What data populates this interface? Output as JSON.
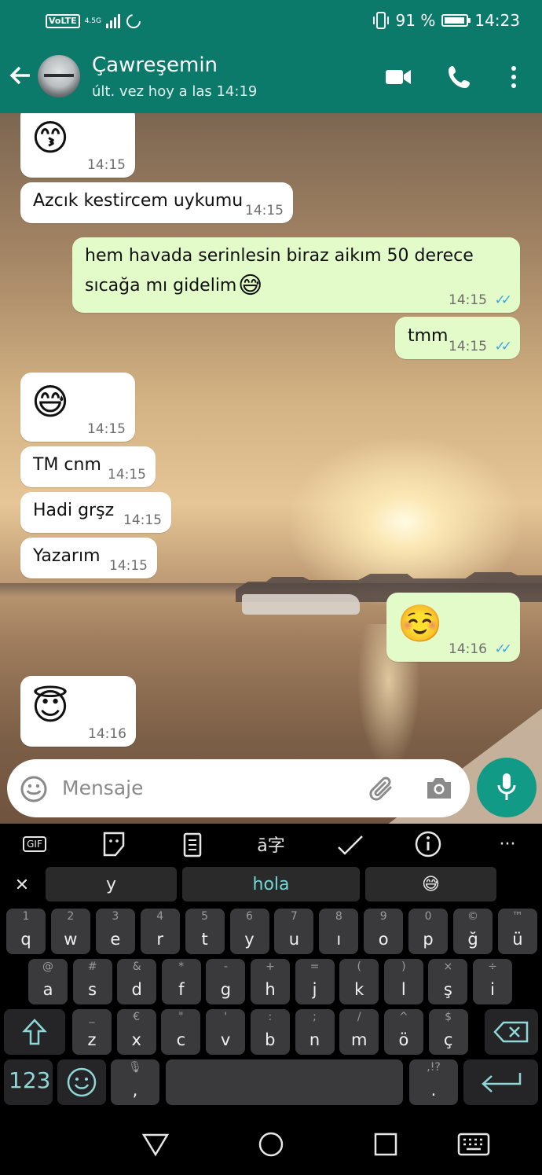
{
  "status_bar": {
    "volte": "VoLTE",
    "network": "4.5G",
    "battery": "91 %",
    "time": "14:23"
  },
  "header": {
    "contact_name": "Çawreşemin",
    "last_seen": "últ. vez hoy a las 14:19"
  },
  "messages": [
    {
      "dir": "in",
      "text": "😙",
      "time": "14:15"
    },
    {
      "dir": "in",
      "text": "Azcık kestircem uykumu",
      "time": "14:15"
    },
    {
      "dir": "out",
      "text_line1": "hem havada serinlesin biraz aikım 50 derece",
      "text_line2": "sıcağa mı gidelim",
      "emoji": "😅",
      "time": "14:15"
    },
    {
      "dir": "out",
      "text": "tmm",
      "time": "14:15"
    },
    {
      "dir": "in",
      "text": "😅",
      "time": "14:15"
    },
    {
      "dir": "in",
      "text": "TM cnm",
      "time": "14:15"
    },
    {
      "dir": "in",
      "text": "Hadi grşz",
      "time": "14:15"
    },
    {
      "dir": "in",
      "text": "Yazarım",
      "time": "14:15"
    },
    {
      "dir": "out",
      "text": "☺️",
      "time": "14:16"
    },
    {
      "dir": "in",
      "text": "😇",
      "time": "14:16"
    }
  ],
  "composer": {
    "placeholder": "Mensaje"
  },
  "keyboard": {
    "toolbar": [
      "GIF",
      "sticker",
      "clipboard",
      "translate",
      "handwriting",
      "info",
      "more"
    ],
    "gif_label": "GIF",
    "suggestions": [
      "y",
      "hola",
      "😅"
    ],
    "row1": [
      {
        "sub": "1",
        "key": "q"
      },
      {
        "sub": "2",
        "key": "w"
      },
      {
        "sub": "3",
        "key": "e"
      },
      {
        "sub": "4",
        "key": "r"
      },
      {
        "sub": "5",
        "key": "t"
      },
      {
        "sub": "6",
        "key": "y"
      },
      {
        "sub": "7",
        "key": "u"
      },
      {
        "sub": "8",
        "key": "ı"
      },
      {
        "sub": "9",
        "key": "o"
      },
      {
        "sub": "0",
        "key": "p"
      },
      {
        "sub": "©",
        "key": "ğ"
      },
      {
        "sub": "™",
        "key": "ü"
      }
    ],
    "row2": [
      {
        "sub": "@",
        "key": "a"
      },
      {
        "sub": "#",
        "key": "s"
      },
      {
        "sub": "&",
        "key": "d"
      },
      {
        "sub": "*",
        "key": "f"
      },
      {
        "sub": "-",
        "key": "g"
      },
      {
        "sub": "+",
        "key": "h"
      },
      {
        "sub": "=",
        "key": "j"
      },
      {
        "sub": "(",
        "key": "k"
      },
      {
        "sub": ")",
        "key": "l"
      },
      {
        "sub": "×",
        "key": "ş"
      },
      {
        "sub": "÷",
        "key": "i"
      }
    ],
    "row3": [
      {
        "sub": "_",
        "key": "z"
      },
      {
        "sub": "€",
        "key": "x"
      },
      {
        "sub": "\"",
        "key": "c"
      },
      {
        "sub": "'",
        "key": "v"
      },
      {
        "sub": ":",
        "key": "b"
      },
      {
        "sub": ";",
        "key": "n"
      },
      {
        "sub": "/",
        "key": "m"
      },
      {
        "sub": "^",
        "key": "ö"
      },
      {
        "sub": "$",
        "key": "ç"
      }
    ],
    "numbers_label": "123",
    "comma": ",",
    "period": ".",
    "period_sub": ",!?"
  }
}
